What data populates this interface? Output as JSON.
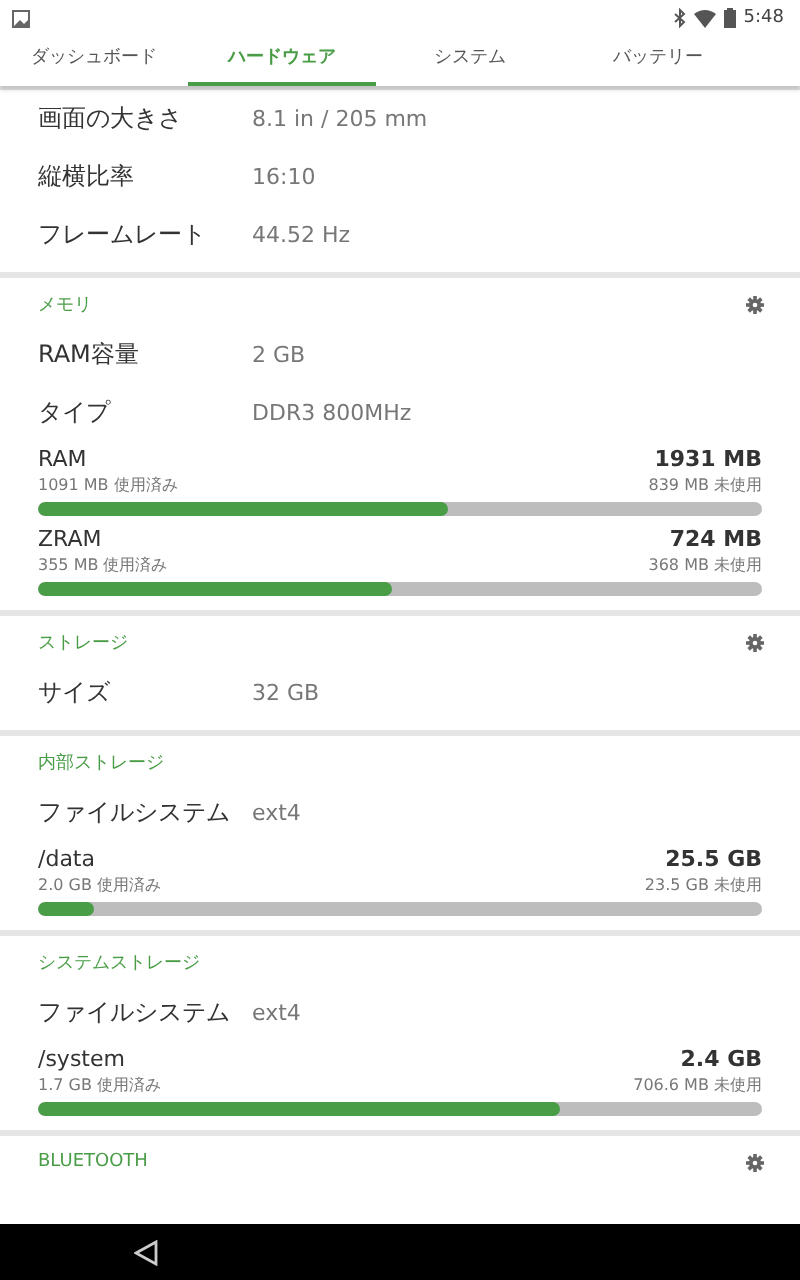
{
  "status_bar": {
    "time": "5:48"
  },
  "tabs": [
    {
      "label": "ダッシュボード",
      "selected": false
    },
    {
      "label": "ハードウェア",
      "selected": true
    },
    {
      "label": "システム",
      "selected": false
    },
    {
      "label": "バッテリー",
      "selected": false
    }
  ],
  "sections": [
    {
      "rows": [
        {
          "kind": "info",
          "label": "画面の大きさ",
          "value": "8.1 in / 205 mm"
        },
        {
          "kind": "info",
          "label": "縦横比率",
          "value": "16:10"
        },
        {
          "kind": "info",
          "label": "フレームレート",
          "value": "44.52 Hz"
        }
      ]
    },
    {
      "title": "メモリ",
      "settings": true,
      "rows": [
        {
          "kind": "info",
          "label": "RAM容量",
          "value": "2 GB"
        },
        {
          "kind": "info",
          "label": "タイプ",
          "value": "DDR3 800MHz"
        },
        {
          "kind": "usage",
          "name": "RAM",
          "total": "1931 MB",
          "used": "1091 MB 使用済み",
          "free": "839 MB 未使用",
          "level": 0.565
        },
        {
          "kind": "usage",
          "name": "ZRAM",
          "total": "724 MB",
          "used": "355 MB 使用済み",
          "free": "368 MB 未使用",
          "level": 0.49
        }
      ]
    },
    {
      "title": "ストレージ",
      "settings": true,
      "rows": [
        {
          "kind": "info",
          "label": "サイズ",
          "value": "32 GB"
        }
      ]
    },
    {
      "title": "内部ストレージ",
      "settings": false,
      "rows": [
        {
          "kind": "info",
          "label": "ファイルシステム",
          "value": "ext4"
        },
        {
          "kind": "usage",
          "name": "/data",
          "total": "25.5 GB",
          "used": "2.0 GB 使用済み",
          "free": "23.5 GB 未使用",
          "level": 0.078
        }
      ]
    },
    {
      "title": "システムストレージ",
      "settings": false,
      "rows": [
        {
          "kind": "info",
          "label": "ファイルシステム",
          "value": "ext4"
        },
        {
          "kind": "usage",
          "name": "/system",
          "total": "2.4 GB",
          "used": "1.7 GB 使用済み",
          "free": "706.6 MB 未使用",
          "level": 0.72
        }
      ]
    },
    {
      "title": "BLUETOOTH",
      "settings": true
    }
  ]
}
